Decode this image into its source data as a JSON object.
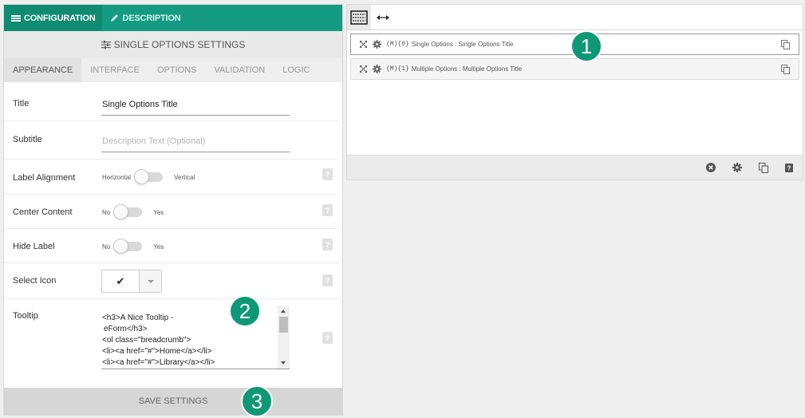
{
  "top_tabs": [
    {
      "label": "CONFIGURATION",
      "icon": "menu-icon",
      "active": true
    },
    {
      "label": "DESCRIPTION",
      "icon": "pen-icon",
      "active": false
    }
  ],
  "settings_header": "SINGLE OPTIONS SETTINGS",
  "sub_tabs": [
    "APPEARANCE",
    "INTERFACE",
    "OPTIONS",
    "VALIDATION",
    "LOGIC"
  ],
  "form": {
    "title": {
      "label": "Title",
      "value": "Single Options Title"
    },
    "subtitle": {
      "label": "Subtitle",
      "placeholder": "Description Text (Optional)"
    },
    "label_alignment": {
      "label": "Label Alignment",
      "off_text": "Horizontal",
      "on_text": "Vertical",
      "state": "off"
    },
    "center_content": {
      "label": "Center Content",
      "off_text": "No",
      "on_text": "Yes",
      "state": "off"
    },
    "hide_label": {
      "label": "Hide Label",
      "off_text": "No",
      "on_text": "Yes",
      "state": "off"
    },
    "select_icon": {
      "label": "Select Icon",
      "value": "✔"
    },
    "tooltip": {
      "label": "Tooltip",
      "lines": [
        "<h3>A Nice Tooltip -",
        "eForm</h3>",
        "<ol class=\"breadcrumb\">",
        "<li><a href=\"#\">Home</a></li>",
        "<li><a href=\"#\">Library</a></li>"
      ]
    },
    "help_glyph": "?"
  },
  "save_label": "SAVE SETTINGS",
  "badges": [
    "1",
    "2",
    "3"
  ],
  "right_panel": {
    "fields": [
      {
        "code": "(M){0}",
        "text": "Single Options : Single Options Title",
        "selected": true
      },
      {
        "code": "(M){1}",
        "text": "Multiple Options : Multiple Options Title",
        "selected": false
      }
    ],
    "footer_icons": [
      "close-circle-icon",
      "gear-icon",
      "copy-icon",
      "help-icon"
    ]
  },
  "colors": {
    "accent": "#159b82",
    "accent_dark": "#0f8b72",
    "badge": "#0f9876"
  }
}
